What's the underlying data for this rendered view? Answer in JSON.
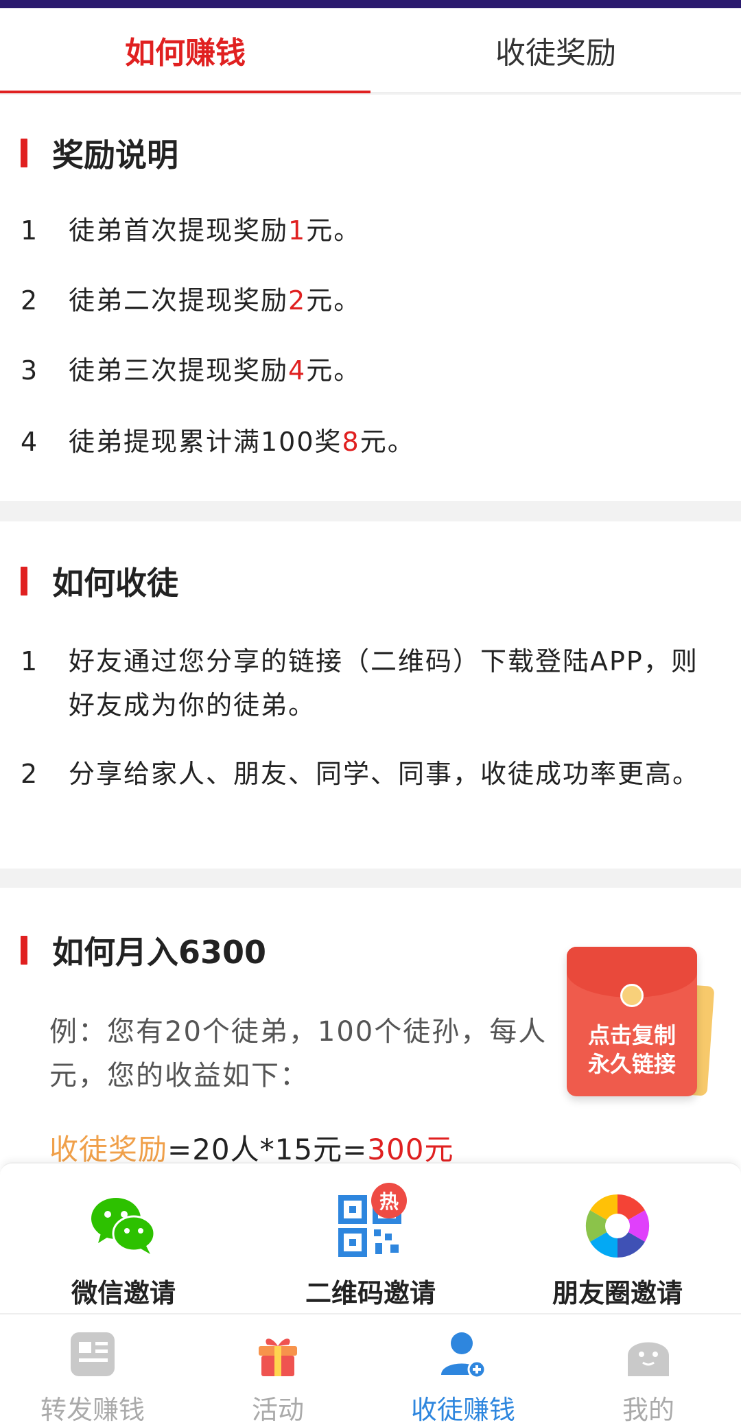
{
  "tabs": [
    {
      "label": "如何赚钱",
      "active": true
    },
    {
      "label": "收徒奖励",
      "active": false
    }
  ],
  "reward": {
    "title": "奖励说明",
    "items": [
      {
        "num": "1",
        "pre": "徒弟首次提现奖励",
        "amount": "1",
        "post": "元。"
      },
      {
        "num": "2",
        "pre": "徒弟二次提现奖励",
        "amount": "2",
        "post": "元。"
      },
      {
        "num": "3",
        "pre": "徒弟三次提现奖励",
        "amount": "4",
        "post": "元。"
      },
      {
        "num": "4",
        "pre": "徒弟提现累计满100奖",
        "amount": "8",
        "post": "元。"
      }
    ]
  },
  "how_recruit": {
    "title": "如何收徒",
    "items": [
      {
        "num": "1",
        "text": "好友通过您分享的链接（二维码）下载登陆APP，则好友成为你的徒弟。"
      },
      {
        "num": "2",
        "text": "分享给家人、朋友、同学、同事，收徒成功率更高。"
      }
    ]
  },
  "monthly": {
    "title": "如何月入6300",
    "example": "例：您有20个徒弟，100个徒孙，每人元，您的收益如下：",
    "calc_label": "收徒奖励",
    "calc_expr": "=20人*15元=",
    "calc_result": "300元"
  },
  "envelope": {
    "line1": "点击复制",
    "line2": "永久链接"
  },
  "invite": [
    {
      "label": "微信邀请",
      "icon": "wechat-icon"
    },
    {
      "label": "二维码邀请",
      "icon": "qrcode-icon",
      "badge": "热"
    },
    {
      "label": "朋友圈邀请",
      "icon": "moments-icon"
    }
  ],
  "nav": [
    {
      "label": "转发赚钱",
      "icon": "news-icon",
      "active": false
    },
    {
      "label": "活动",
      "icon": "gift-icon",
      "active": false
    },
    {
      "label": "收徒赚钱",
      "icon": "user-add-icon",
      "active": true
    },
    {
      "label": "我的",
      "icon": "profile-icon",
      "active": false
    }
  ],
  "colors": {
    "accent": "#e02020",
    "nav_active": "#2e86de",
    "orange": "#f0a04a"
  }
}
